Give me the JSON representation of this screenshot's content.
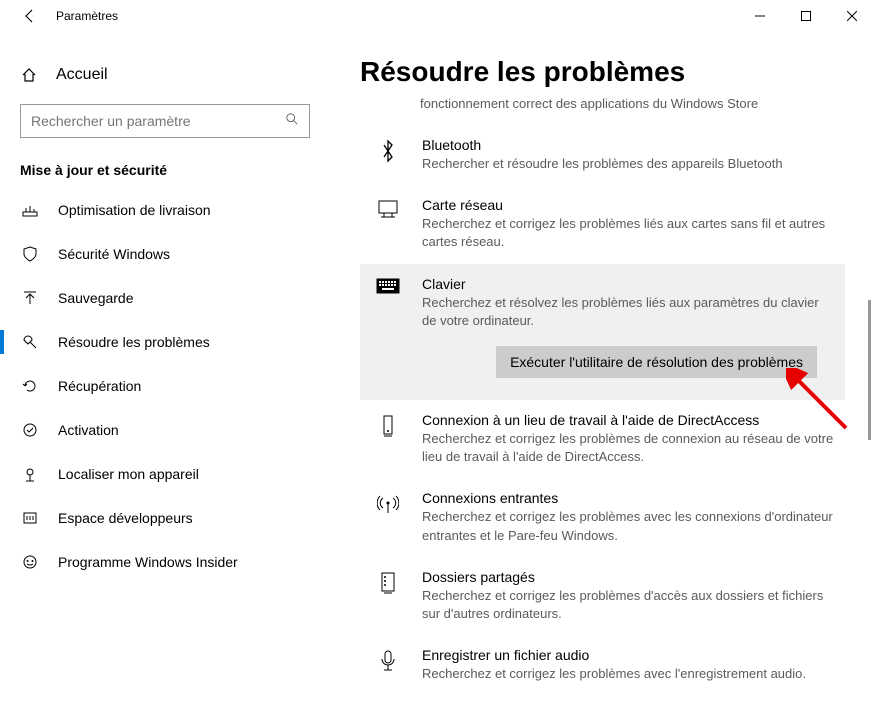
{
  "window": {
    "title": "Paramètres"
  },
  "home": {
    "label": "Accueil"
  },
  "search": {
    "placeholder": "Rechercher un paramètre"
  },
  "section": {
    "title": "Mise à jour et sécurité"
  },
  "nav": {
    "items": [
      {
        "label": "Optimisation de livraison"
      },
      {
        "label": "Sécurité Windows"
      },
      {
        "label": "Sauvegarde"
      },
      {
        "label": "Résoudre les problèmes"
      },
      {
        "label": "Récupération"
      },
      {
        "label": "Activation"
      },
      {
        "label": "Localiser mon appareil"
      },
      {
        "label": "Espace développeurs"
      },
      {
        "label": "Programme Windows Insider"
      }
    ]
  },
  "page": {
    "heading": "Résoudre les problèmes",
    "sub": "fonctionnement correct des applications du Windows Store"
  },
  "troubleshooters": [
    {
      "title": "Bluetooth",
      "desc": "Rechercher et résoudre les problèmes des appareils Bluetooth"
    },
    {
      "title": "Carte réseau",
      "desc": "Recherchez et corrigez les problèmes liés aux cartes sans fil et autres cartes réseau."
    },
    {
      "title": "Clavier",
      "desc": "Recherchez et résolvez les problèmes liés aux paramètres du clavier de votre ordinateur.",
      "run": "Exécuter l'utilitaire de résolution des problèmes"
    },
    {
      "title": "Connexion à un lieu de travail à l'aide de DirectAccess",
      "desc": "Recherchez et corrigez les problèmes de connexion au réseau de votre lieu de travail à l'aide de DirectAccess."
    },
    {
      "title": "Connexions entrantes",
      "desc": "Recherchez et corrigez les problèmes avec les connexions d'ordinateur entrantes et le Pare-feu Windows."
    },
    {
      "title": "Dossiers partagés",
      "desc": "Recherchez et corrigez les problèmes d'accès aux dossiers et fichiers sur d'autres ordinateurs."
    },
    {
      "title": "Enregistrer un fichier audio",
      "desc": "Recherchez et corrigez les problèmes avec l'enregistrement audio."
    }
  ]
}
